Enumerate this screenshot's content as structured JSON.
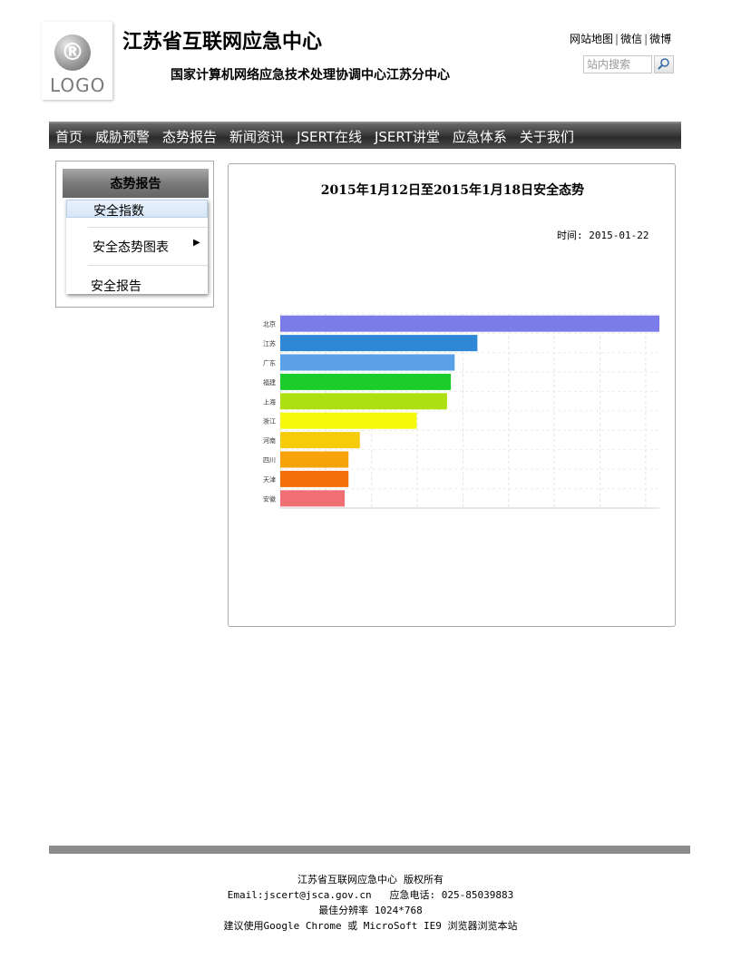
{
  "header": {
    "logo_symbol": "®",
    "logo_text": "LOGO",
    "title": "江苏省互联网应急中心",
    "subtitle": "国家计算机网络应急技术处理协调中心江苏分中心",
    "top_links": [
      "网站地图",
      "微信",
      "微博"
    ],
    "top_links_separator": "|",
    "search": {
      "placeholder": "站内搜索",
      "value": "",
      "button_icon": "search-icon"
    }
  },
  "nav": {
    "items": [
      "首页",
      "威胁预警",
      "态势报告",
      "新闻资讯",
      "JSERT在线",
      "JSERT讲堂",
      "应急体系",
      "关于我们"
    ]
  },
  "sidebar": {
    "title": "态势报告",
    "items": [
      {
        "label": "安全指数",
        "active": true
      },
      {
        "label": "安全态势图表",
        "has_submenu": true,
        "submenu_icon": "caret-right-icon"
      },
      {
        "label": "安全报告"
      }
    ]
  },
  "content": {
    "title": "2015年1月12日至2015年1月18日安全态势",
    "time_label": "时间:",
    "time_value": "2015-01-22"
  },
  "chart_data": {
    "type": "bar",
    "orientation": "horizontal",
    "categories": [
      "北京",
      "江苏",
      "广东",
      "福建",
      "上海",
      "浙江",
      "河南",
      "四川",
      "天津",
      "安徽"
    ],
    "values": [
      100,
      52,
      46,
      45,
      44,
      36,
      21,
      18,
      18,
      17
    ],
    "colors": [
      "#7b7bea",
      "#2f87d6",
      "#5aa0e6",
      "#1bcc2b",
      "#aee011",
      "#f5fa0c",
      "#f5cb0a",
      "#f8a20c",
      "#f6700a",
      "#ef6f74"
    ],
    "xlim": [
      0,
      100
    ],
    "grid": true
  },
  "footer": {
    "copyright": "江苏省互联网应急中心  版权所有",
    "contact": "Email:jscert@jsca.gov.cn   应急电话: 025-85039883",
    "resolution": "最佳分辨率 1024*768",
    "browser": "建议使用Google Chrome 或 MicroSoft IE9 浏览器浏览本站"
  }
}
